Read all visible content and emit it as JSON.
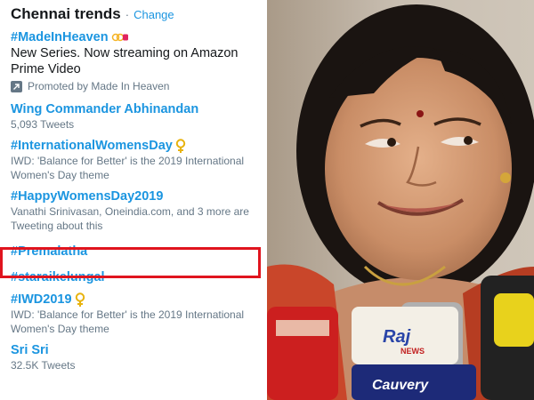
{
  "trends": {
    "title": "Chennai trends",
    "separator": "·",
    "change_label": "Change",
    "items": [
      {
        "name": "#MadeInHeaven",
        "desc": "New Series. Now streaming on Amazon Prime Video",
        "promoted": "Promoted by Made In Heaven"
      },
      {
        "name": "Wing Commander Abhinandan",
        "meta": "5,093 Tweets"
      },
      {
        "name": "#InternationalWomensDay",
        "meta": "IWD: 'Balance for Better' is the 2019 International Women's Day theme"
      },
      {
        "name": "#HappyWomensDay2019",
        "meta": "Vanathi Srinivasan, Oneindia.com, and 3 more are Tweeting about this"
      },
      {
        "name": "#Premalatha"
      },
      {
        "name": "#staraikelungal"
      },
      {
        "name": "#IWD2019",
        "meta": "IWD: 'Balance for Better' is the 2019 International Women's Day theme"
      },
      {
        "name": "Sri Sri",
        "meta": "32.5K Tweets"
      }
    ]
  },
  "colors": {
    "link": "#1b95e0",
    "highlight": "#e0141e",
    "muted": "#657786"
  },
  "photo": {
    "mic_logo_1": "Raj",
    "mic_logo_1_sub": "NEWS",
    "mic_logo_2": "Cauvery"
  }
}
